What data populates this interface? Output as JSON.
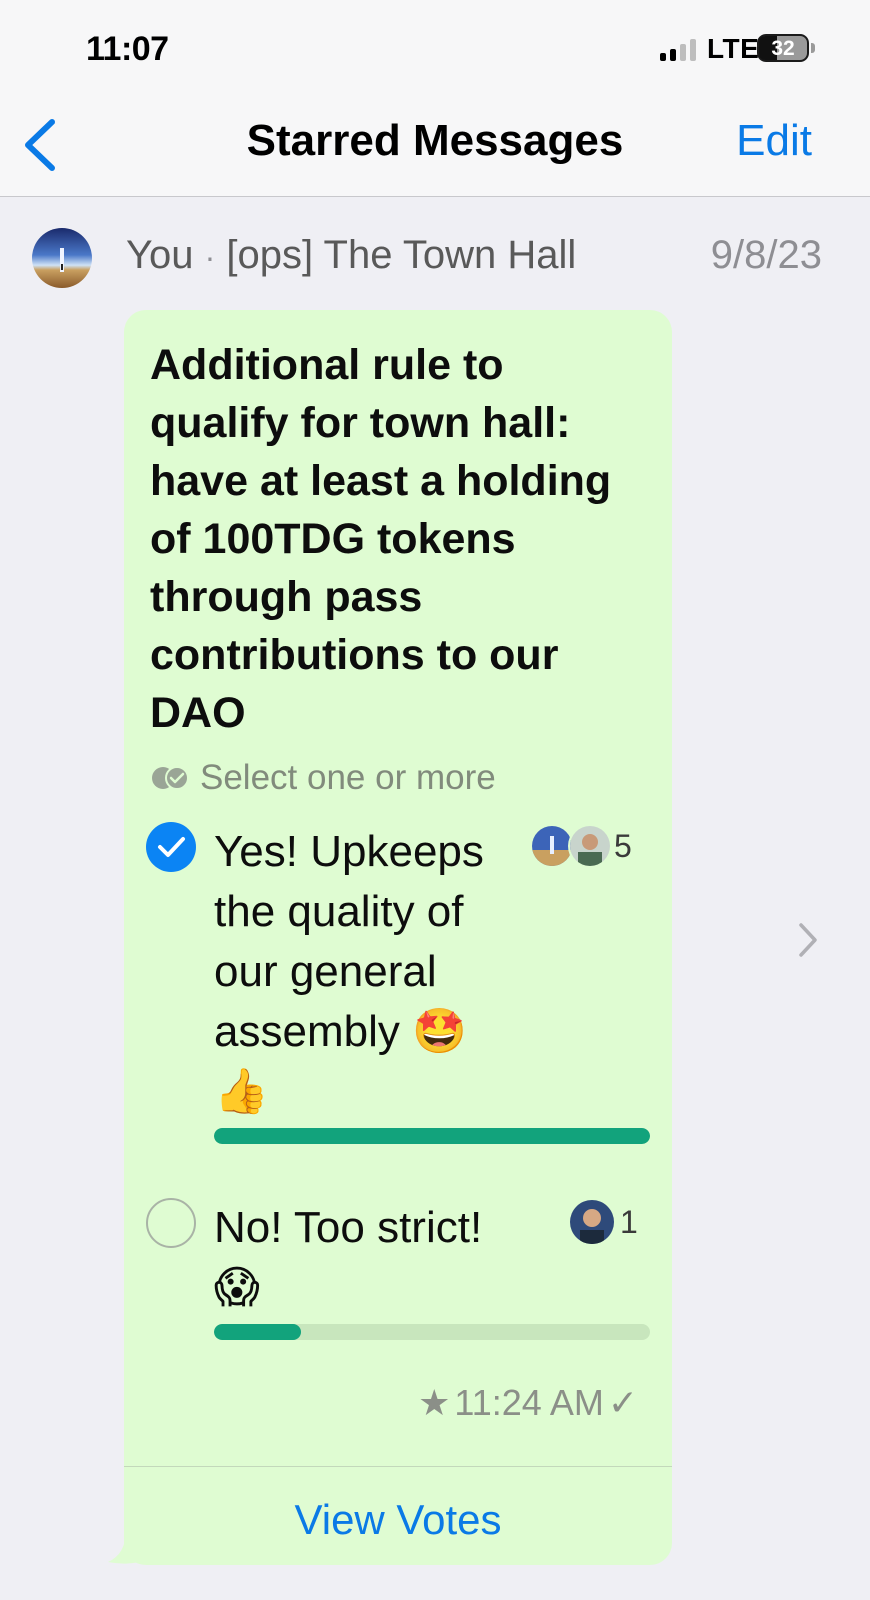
{
  "status_bar": {
    "time": "11:07",
    "network": "LTE",
    "battery": "32"
  },
  "nav": {
    "title": "Starred Messages",
    "edit_label": "Edit",
    "back_icon": "chevron-left-icon"
  },
  "message": {
    "sender": "You",
    "separator": "·",
    "chat": "[ops] The Town Hall",
    "date": "9/8/23",
    "poll": {
      "question": "Additional rule to qualify for town hall: have at least a holding of 100TDG tokens through pass contributions to our DAO",
      "hint": "Select one or more",
      "options": [
        {
          "label": "Yes! Upkeeps the quality of our general assembly",
          "emoji": "🤩 👍",
          "votes": "5",
          "selected": true,
          "share": 1.0
        },
        {
          "label": "No! Too strict!",
          "emoji": "😱",
          "votes": "1",
          "selected": false,
          "share": 0.2
        }
      ]
    },
    "time": "11:24 AM",
    "star": "★",
    "tick": "✓",
    "view_votes": "View Votes"
  },
  "colors": {
    "accent": "#0a7ae6",
    "bubble": "#dffcd2",
    "bar": "#12a37c",
    "check": "#0b84f4"
  }
}
